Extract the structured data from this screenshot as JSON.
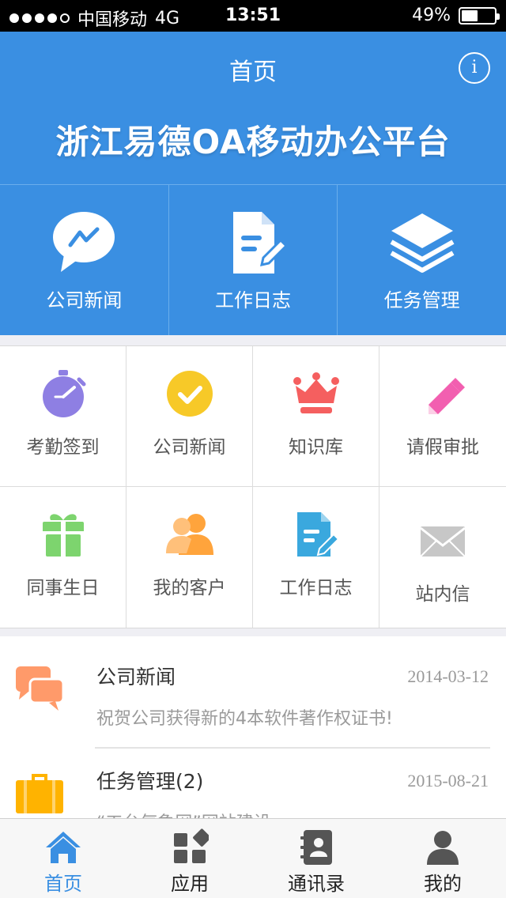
{
  "status_bar": {
    "carrier": "中国移动",
    "network": "4G",
    "time": "13:51",
    "battery": "49%",
    "battery_level": 0.49
  },
  "header": {
    "title": "首页",
    "info_glyph": "i",
    "banner": "浙江易德OA移动办公平台"
  },
  "quick": [
    {
      "label": "公司新闻",
      "icon": "chat-bubble-icon"
    },
    {
      "label": "工作日志",
      "icon": "document-edit-icon"
    },
    {
      "label": "任务管理",
      "icon": "layers-icon"
    }
  ],
  "apps": [
    {
      "label": "考勤签到",
      "icon": "stopwatch-icon",
      "color": "#8e7fe3"
    },
    {
      "label": "公司新闻",
      "icon": "check-circle-icon",
      "color": "#f7c928"
    },
    {
      "label": "知识库",
      "icon": "crown-icon",
      "color": "#f55f5f"
    },
    {
      "label": "请假审批",
      "icon": "pencil-icon",
      "color": "#f25fb0"
    },
    {
      "label": "同事生日",
      "icon": "gift-icon",
      "color": "#7dd46e"
    },
    {
      "label": "我的客户",
      "icon": "users-icon",
      "color": "#ffa43c"
    },
    {
      "label": "工作日志",
      "icon": "document-edit-icon",
      "color": "#3aa8de"
    },
    {
      "label": "站内信",
      "icon": "envelope-icon",
      "color": "#c7c7c7"
    }
  ],
  "feed": [
    {
      "title": "公司新闻",
      "date": "2014-03-12",
      "subtitle": "祝贺公司获得新的4本软件著作权证书!",
      "icon": "chat-bubbles-icon",
      "color": "#ff9a6a"
    },
    {
      "title": "任务管理(2)",
      "date": "2015-08-21",
      "subtitle": "“工台气象网”网站建设",
      "icon": "briefcase-icon",
      "color": "#ffb300"
    }
  ],
  "tabs": [
    {
      "label": "首页",
      "icon": "home-icon",
      "active": true
    },
    {
      "label": "应用",
      "icon": "apps-icon",
      "active": false
    },
    {
      "label": "通讯录",
      "icon": "contacts-icon",
      "active": false
    },
    {
      "label": "我的",
      "icon": "profile-icon",
      "active": false
    }
  ],
  "colors": {
    "primary": "#3a8fe2",
    "tab_inactive": "#555555"
  }
}
